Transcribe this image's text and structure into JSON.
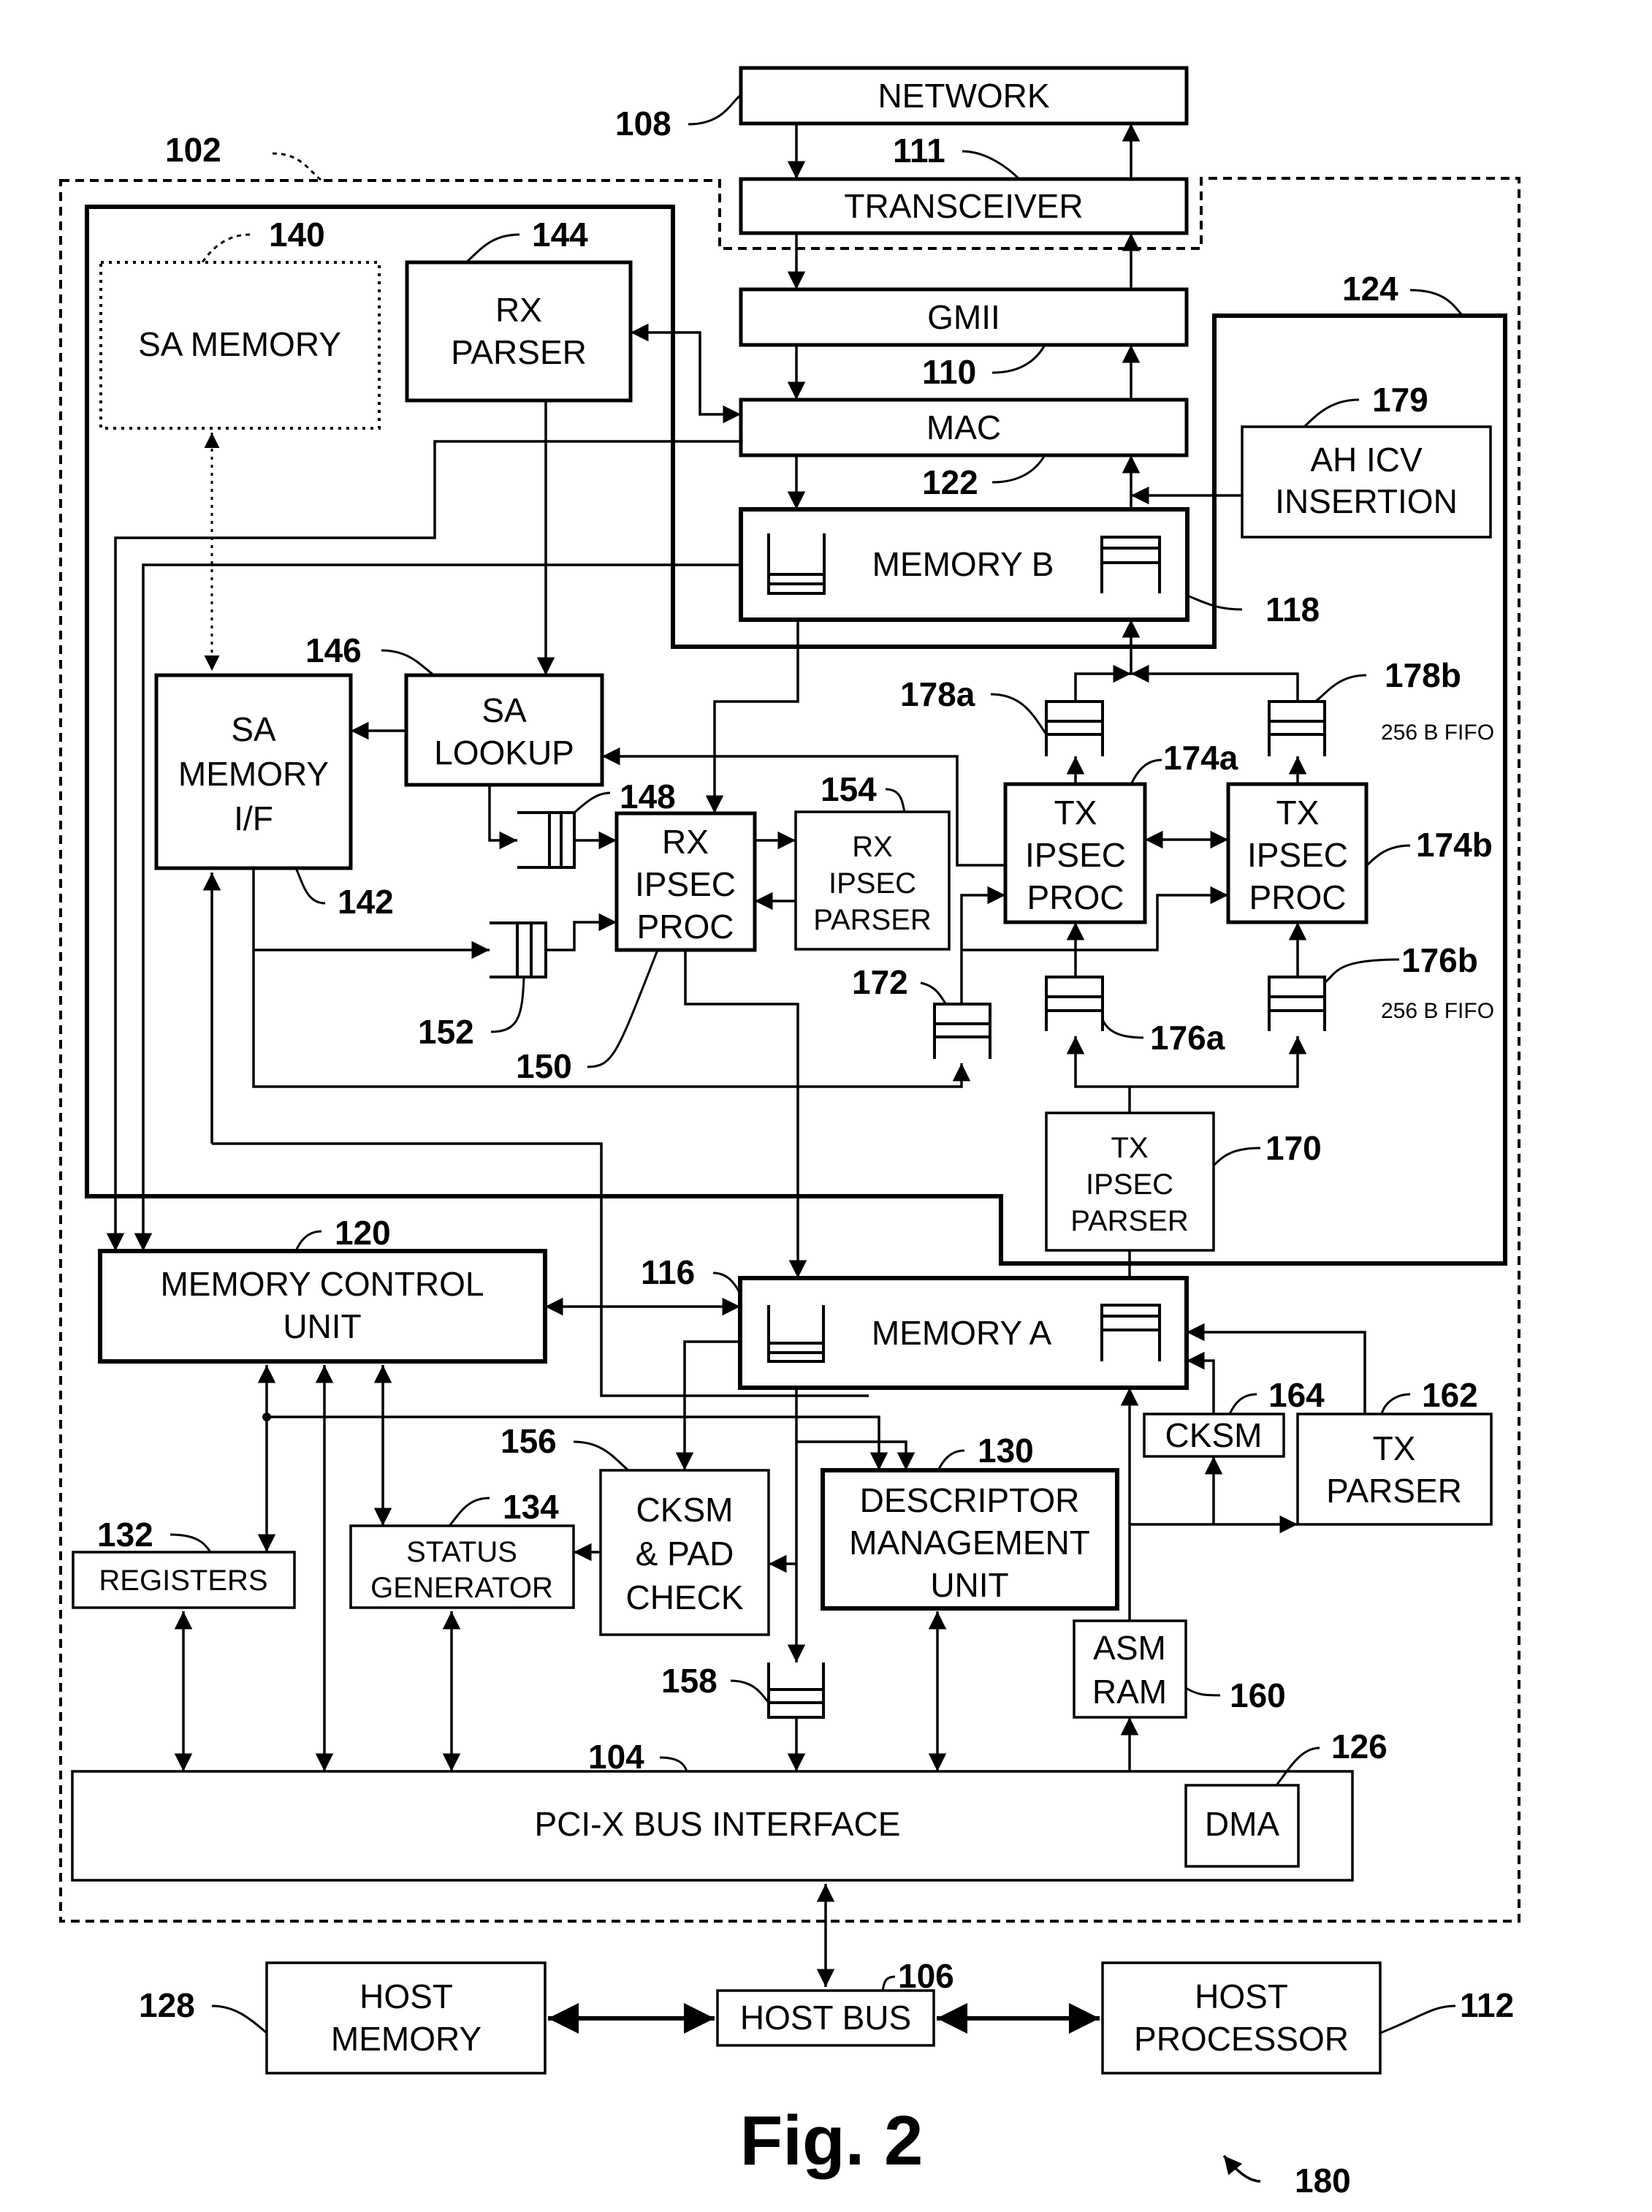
{
  "figure": {
    "caption": "Fig. 2",
    "ref": "180"
  },
  "blocks": {
    "network": {
      "label": "NETWORK",
      "ref": "108"
    },
    "transceiver": {
      "label": "TRANSCEIVER",
      "ref": "111"
    },
    "gmii": {
      "label": "GMII",
      "ref": "110"
    },
    "mac": {
      "label": "MAC",
      "ref": "122"
    },
    "memory_b": {
      "label": "MEMORY B",
      "ref": "118"
    },
    "ah_icv": {
      "line1": "AH ICV",
      "line2": "INSERTION",
      "ref": "179"
    },
    "sa_memory": {
      "label": "SA MEMORY",
      "ref": "140"
    },
    "rx_parser": {
      "line1": "RX",
      "line2": "PARSER",
      "ref": "144"
    },
    "sa_memory_if": {
      "line1": "SA",
      "line2": "MEMORY",
      "line3": "I/F",
      "ref": "142"
    },
    "sa_lookup": {
      "line1": "SA",
      "line2": "LOOKUP",
      "ref": "146"
    },
    "rx_ipsec_proc": {
      "line1": "RX",
      "line2": "IPSEC",
      "line3": "PROC",
      "ref": "150"
    },
    "rx_ipsec_parser": {
      "line1": "RX",
      "line2": "IPSEC",
      "line3": "PARSER",
      "ref": "154"
    },
    "tx_ipsec_proc_a": {
      "line1": "TX",
      "line2": "IPSEC",
      "line3": "PROC",
      "ref": "174a"
    },
    "tx_ipsec_proc_b": {
      "line1": "TX",
      "line2": "IPSEC",
      "line3": "PROC",
      "ref": "174b"
    },
    "tx_ipsec_parser": {
      "line1": "TX",
      "line2": "IPSEC",
      "line3": "PARSER",
      "ref": "170"
    },
    "memory_control_unit": {
      "line1": "MEMORY CONTROL",
      "line2": "UNIT",
      "ref": "120"
    },
    "memory_a": {
      "label": "MEMORY A",
      "ref": "116"
    },
    "cksm": {
      "label": "CKSM",
      "ref": "164"
    },
    "tx_parser": {
      "line1": "TX",
      "line2": "PARSER",
      "ref": "162"
    },
    "descriptor_mgmt": {
      "line1": "DESCRIPTOR",
      "line2": "MANAGEMENT",
      "line3": "UNIT",
      "ref": "130"
    },
    "cksm_pad_check": {
      "line1": "CKSM",
      "line2": "& PAD",
      "line3": "CHECK",
      "ref": "156"
    },
    "status_generator": {
      "line1": "STATUS",
      "line2": "GENERATOR",
      "ref": "134"
    },
    "registers": {
      "label": "REGISTERS",
      "ref": "132"
    },
    "asm_ram": {
      "line1": "ASM",
      "line2": "RAM",
      "ref": "160"
    },
    "pcix_bus_interface": {
      "label": "PCI-X BUS INTERFACE",
      "ref": "104"
    },
    "dma": {
      "label": "DMA",
      "ref": "126"
    },
    "host_memory": {
      "line1": "HOST",
      "line2": "MEMORY",
      "ref": "128"
    },
    "host_bus": {
      "label": "HOST BUS",
      "ref": "106"
    },
    "host_processor": {
      "line1": "HOST",
      "line2": "PROCESSOR",
      "ref": "112"
    }
  },
  "fifos": {
    "fifo_148": {
      "ref": "148"
    },
    "fifo_152": {
      "ref": "152"
    },
    "fifo_158": {
      "ref": "158"
    },
    "fifo_172": {
      "ref": "172"
    },
    "fifo_176a": {
      "ref": "176a"
    },
    "fifo_176b": {
      "ref": "176b",
      "note": "256 B FIFO"
    },
    "fifo_178a": {
      "ref": "178a"
    },
    "fifo_178b": {
      "ref": "178b",
      "note": "256 B FIFO"
    }
  },
  "regions": {
    "chip": {
      "ref": "102"
    },
    "ipsec_tx_region": {
      "ref": "124"
    }
  }
}
